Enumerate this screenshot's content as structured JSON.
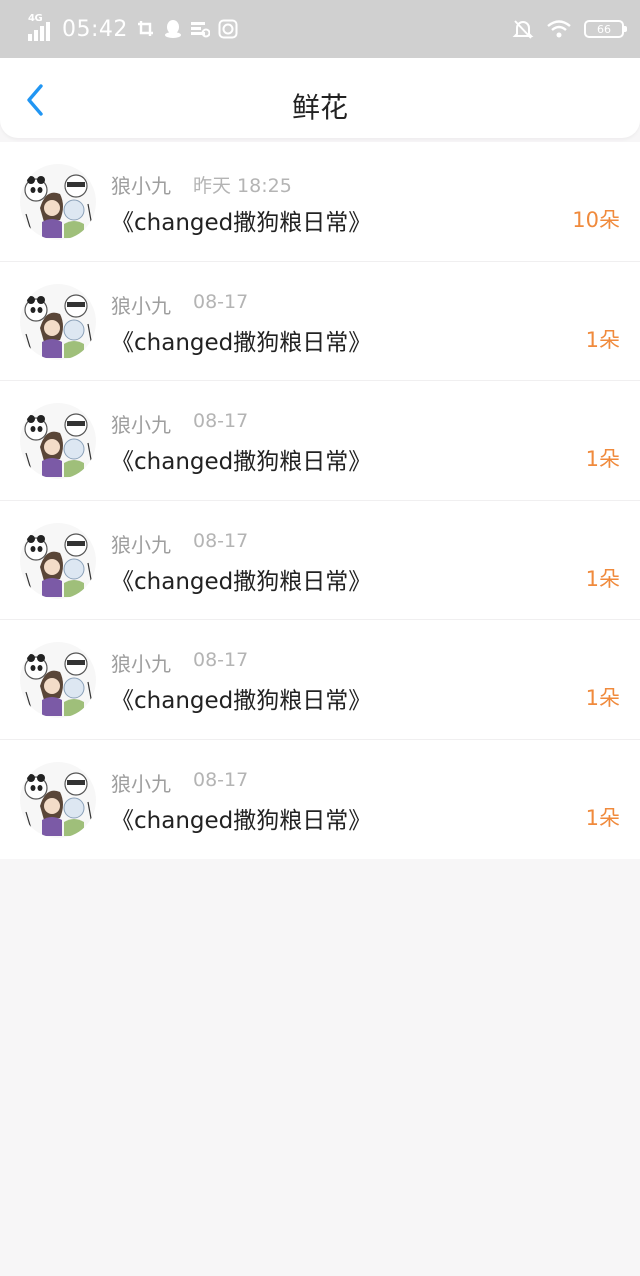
{
  "status_bar": {
    "network": "4G",
    "time": "05:42",
    "battery": "66",
    "icons": [
      "signal-icon",
      "screenshot-icon",
      "qq-icon",
      "notes-icon",
      "sync-icon",
      "bell-off-icon",
      "wifi-icon",
      "battery-icon"
    ]
  },
  "header": {
    "title": "鲜花",
    "back_icon": "chevron-left-icon"
  },
  "colors": {
    "accent": "#2196f3",
    "count": "#f08a3c",
    "status_bar_bg": "#d0d0d0",
    "page_bg": "#f7f6f7"
  },
  "records": [
    {
      "name": "狼小九",
      "time": "昨天 18:25",
      "book": "《changed撒狗粮日常》",
      "count": "10朵"
    },
    {
      "name": "狼小九",
      "time": "08-17",
      "book": "《changed撒狗粮日常》",
      "count": "1朵"
    },
    {
      "name": "狼小九",
      "time": "08-17",
      "book": "《changed撒狗粮日常》",
      "count": "1朵"
    },
    {
      "name": "狼小九",
      "time": "08-17",
      "book": "《changed撒狗粮日常》",
      "count": "1朵"
    },
    {
      "name": "狼小九",
      "time": "08-17",
      "book": "《changed撒狗粮日常》",
      "count": "1朵"
    },
    {
      "name": "狼小九",
      "time": "08-17",
      "book": "《changed撒狗粮日常》",
      "count": "1朵"
    }
  ]
}
